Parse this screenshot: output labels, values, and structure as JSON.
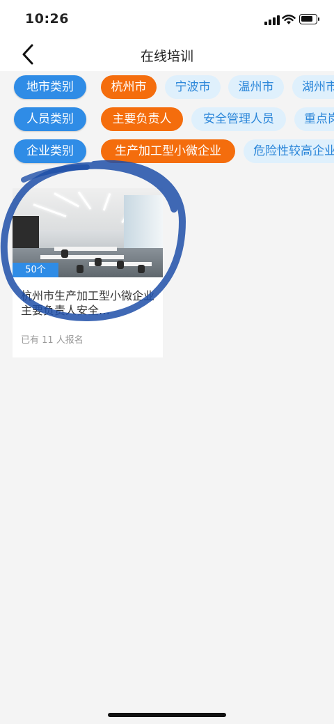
{
  "status": {
    "time": "10:26"
  },
  "nav": {
    "title": "在线培训"
  },
  "filters": {
    "region": {
      "label": "地市类别",
      "options": [
        "杭州市",
        "宁波市",
        "温州市",
        "湖州市"
      ],
      "selected": "杭州市"
    },
    "personnel": {
      "label": "人员类别",
      "options": [
        "主要负责人",
        "安全管理人员",
        "重点岗"
      ],
      "selected": "主要负责人"
    },
    "enterprise": {
      "label": "企业类别",
      "options": [
        "生产加工型小微企业",
        "危险性较高企业"
      ],
      "selected": "生产加工型小微企业"
    }
  },
  "courses": [
    {
      "count_badge": "50个",
      "title": "杭州市生产加工型小微企业主要负责人安全…",
      "enrolled": "已有 11 人报名"
    }
  ],
  "colors": {
    "primary": "#2f8ce6",
    "active": "#f46d0d",
    "option_bg": "#dff0fc",
    "annotation": "#1e4fa8"
  }
}
